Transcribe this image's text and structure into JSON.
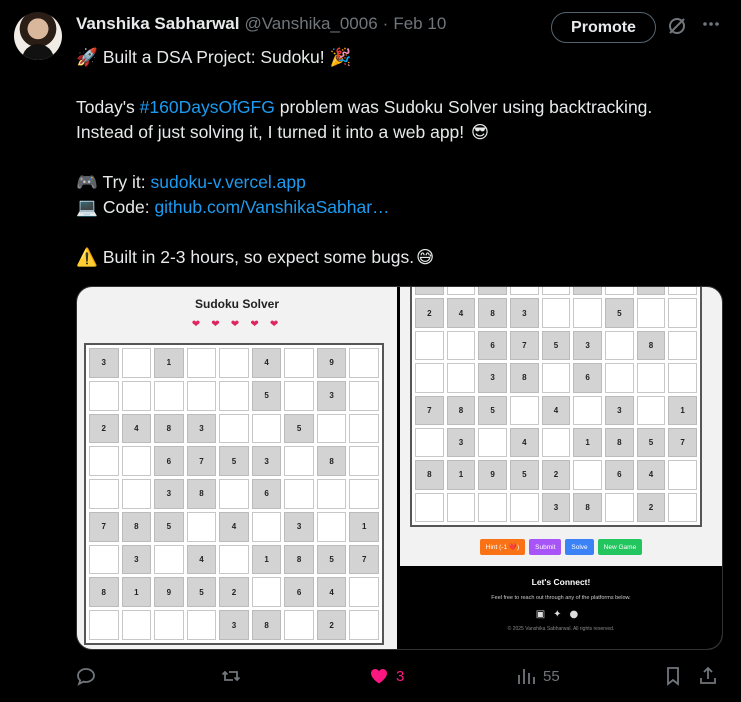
{
  "tweet": {
    "author": "Vanshika Sabharwal",
    "handle": "@Vanshika_0006",
    "separator": "·",
    "date": "Feb 10",
    "promote_label": "Promote",
    "lines": {
      "l1_emoji": "🚀",
      "l1_text": " Built a DSA Project: Sudoku! ",
      "l1_emoji2": "🎉",
      "l3_a": "Today's ",
      "l3_hashtag": "#160DaysOfGFG",
      "l3_b": " problem was Sudoku Solver using backtracking.",
      "l4": "Instead of just solving it, I turned it into a web app! ",
      "l4_emoji": "😎",
      "l6_emoji": "🎮",
      "l6_text": " Try it: ",
      "l6_link": "sudoku-v.vercel.app",
      "l7_emoji": "💻",
      "l7_text": " Code: ",
      "l7_link": "github.com/VanshikaSabhar…",
      "l9_emoji": "⚠️",
      "l9_text": " Built in 2-3 hours, so expect some bugs.",
      "l9_emoji2": "😅"
    }
  },
  "media": {
    "left": {
      "title": "Sudoku Solver",
      "hearts": "❤ ❤ ❤ ❤ ❤",
      "grid": [
        [
          "3",
          "",
          "1",
          "",
          "",
          "4",
          "",
          "9",
          ""
        ],
        [
          "",
          "",
          "",
          "",
          "",
          "5",
          "",
          "3",
          ""
        ],
        [
          "2",
          "4",
          "8",
          "3",
          "",
          "",
          "5",
          "",
          ""
        ],
        [
          "",
          "",
          "6",
          "7",
          "5",
          "3",
          "",
          "8",
          ""
        ],
        [
          "",
          "",
          "3",
          "8",
          "",
          "6",
          "",
          "",
          ""
        ],
        [
          "7",
          "8",
          "5",
          "",
          "4",
          "",
          "3",
          "",
          "1"
        ],
        [
          "",
          "3",
          "",
          "4",
          "",
          "1",
          "8",
          "5",
          "7"
        ],
        [
          "8",
          "1",
          "9",
          "5",
          "2",
          "",
          "6",
          "4",
          ""
        ],
        [
          "",
          "",
          "",
          "",
          "3",
          "8",
          "",
          "2",
          ""
        ]
      ],
      "fixed": [
        [
          1,
          0,
          1,
          0,
          0,
          1,
          0,
          1,
          0
        ],
        [
          0,
          0,
          0,
          0,
          0,
          1,
          0,
          1,
          0
        ],
        [
          1,
          1,
          1,
          1,
          0,
          0,
          1,
          0,
          0
        ],
        [
          0,
          0,
          1,
          1,
          1,
          1,
          0,
          1,
          0
        ],
        [
          0,
          0,
          1,
          1,
          0,
          1,
          0,
          0,
          0
        ],
        [
          1,
          1,
          1,
          0,
          1,
          0,
          1,
          0,
          1
        ],
        [
          0,
          1,
          0,
          1,
          0,
          1,
          1,
          1,
          1
        ],
        [
          1,
          1,
          1,
          1,
          1,
          0,
          1,
          1,
          0
        ],
        [
          0,
          0,
          0,
          0,
          1,
          1,
          0,
          1,
          0
        ]
      ]
    },
    "right": {
      "grid": [
        [
          "",
          "",
          "",
          "",
          "",
          "",
          "",
          "",
          ""
        ],
        [
          "2",
          "4",
          "8",
          "3",
          "",
          "",
          "5",
          "",
          ""
        ],
        [
          "",
          "",
          "6",
          "7",
          "5",
          "3",
          "",
          "8",
          ""
        ],
        [
          "",
          "",
          "3",
          "8",
          "",
          "6",
          "",
          "",
          ""
        ],
        [
          "7",
          "8",
          "5",
          "",
          "4",
          "",
          "3",
          "",
          "1"
        ],
        [
          "",
          "3",
          "",
          "4",
          "",
          "1",
          "8",
          "5",
          "7"
        ],
        [
          "8",
          "1",
          "9",
          "5",
          "2",
          "",
          "6",
          "4",
          ""
        ],
        [
          "",
          "",
          "",
          "",
          "3",
          "8",
          "",
          "2",
          ""
        ]
      ],
      "fixed": [
        [
          1,
          0,
          1,
          0,
          0,
          1,
          0,
          1,
          0
        ],
        [
          1,
          1,
          1,
          1,
          0,
          0,
          1,
          0,
          0
        ],
        [
          0,
          0,
          1,
          1,
          1,
          1,
          0,
          1,
          0
        ],
        [
          0,
          0,
          1,
          1,
          0,
          1,
          0,
          0,
          0
        ],
        [
          1,
          1,
          1,
          0,
          1,
          0,
          1,
          0,
          1
        ],
        [
          0,
          1,
          0,
          1,
          0,
          1,
          1,
          1,
          1
        ],
        [
          1,
          1,
          1,
          1,
          1,
          0,
          1,
          1,
          0
        ],
        [
          0,
          0,
          0,
          0,
          1,
          1,
          0,
          1,
          0
        ]
      ],
      "buttons": [
        {
          "label": "Hint (-1 ❤️)",
          "color": "#f97316"
        },
        {
          "label": "Submit",
          "color": "#a855f7"
        },
        {
          "label": "Solve",
          "color": "#3b82f6"
        },
        {
          "label": "New Game",
          "color": "#22c55e"
        }
      ],
      "footer": {
        "title": "Let's Connect!",
        "text": "Feel free to reach out through any of the platforms below.",
        "copyright": "© 2025 Vanshika Sabharwal. All rights reserved."
      }
    }
  },
  "actions": {
    "likes": "3",
    "views": "55",
    "like_color": "#f91880"
  }
}
